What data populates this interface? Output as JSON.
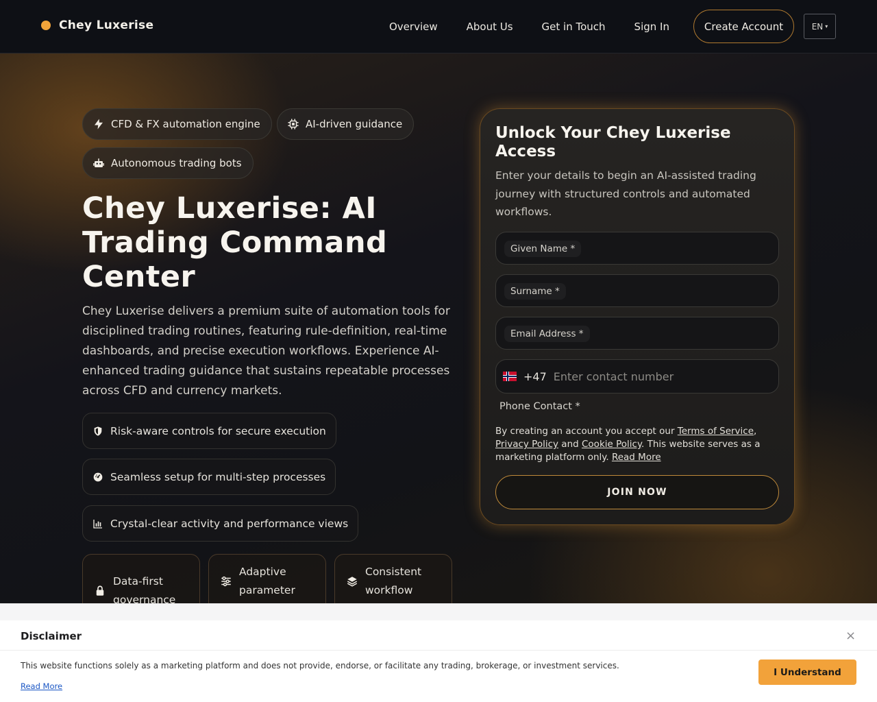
{
  "brand": {
    "name": "Chey Luxerise",
    "accent": "#f2a43a"
  },
  "nav": {
    "links": [
      "Overview",
      "About Us",
      "Get in Touch",
      "Sign In"
    ],
    "create_account": "Create Account",
    "language": "EN",
    "language_caret": "▾"
  },
  "hero": {
    "pills": [
      "CFD & FX automation engine",
      "AI-driven guidance",
      "Autonomous trading bots"
    ],
    "headline": "Chey Luxerise: AI Trading Command Center",
    "lead": "Chey Luxerise delivers a premium suite of automation tools for disciplined trading routines, featuring rule-definition, real-time dashboards, and precise execution workflows. Experience AI-enhanced trading guidance that sustains repeatable processes across CFD and currency markets.",
    "features": [
      "Risk-aware controls for secure execution",
      "Seamless setup for multi-step processes",
      "Crystal-clear activity and performance views"
    ],
    "cards": [
      "Data-first governance",
      "Adaptive parameter",
      "Consistent workflow"
    ]
  },
  "form": {
    "title": "Unlock Your Chey Luxerise Access",
    "subtitle": "Enter your details to begin an AI-assisted trading journey with structured controls and automated workflows.",
    "given_name_label": "Given Name *",
    "surname_label": "Surname *",
    "email_label": "Email Address *",
    "dial_code": "+47",
    "phone_placeholder": "Enter contact number",
    "phone_label": "Phone Contact *",
    "terms_prefix": "By creating an account you accept our ",
    "terms_of_service": "Terms of Service",
    "comma": ",",
    "privacy_policy": "Privacy Policy",
    "and": " and ",
    "cookie_policy": "Cookie Policy",
    "terms_suffix": ". This website serves as a marketing platform only. ",
    "read_more": "Read More",
    "join": "JOIN NOW"
  },
  "disclaimer": {
    "title": "Disclaimer",
    "close": "×",
    "text": "This website functions solely as a marketing platform and does not provide, endorse, or facilitate any trading, brokerage, or investment services.",
    "read_more": "Read More",
    "button": "I Understand"
  }
}
